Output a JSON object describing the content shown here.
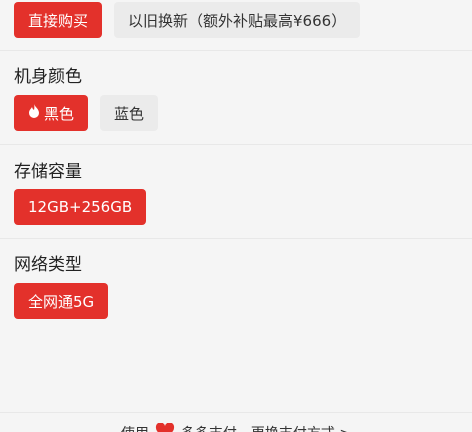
{
  "top_actions": {
    "buy_now": "直接购买",
    "trade_in": "以旧换新（额外补贴最高¥666）"
  },
  "color": {
    "title": "机身颜色",
    "options": [
      "黑色",
      "蓝色"
    ],
    "selected_index": 0
  },
  "storage": {
    "title": "存储容量",
    "options": [
      "12GB+256GB"
    ]
  },
  "network": {
    "title": "网络类型",
    "options": [
      "全网通5G"
    ]
  },
  "footer": {
    "text_prefix": "使用",
    "text_suffix": "多多支付，更换支付方式 >"
  },
  "colors": {
    "accent": "#e3312b",
    "unselected_bg": "#ebebeb",
    "background": "#f5f5f5"
  }
}
